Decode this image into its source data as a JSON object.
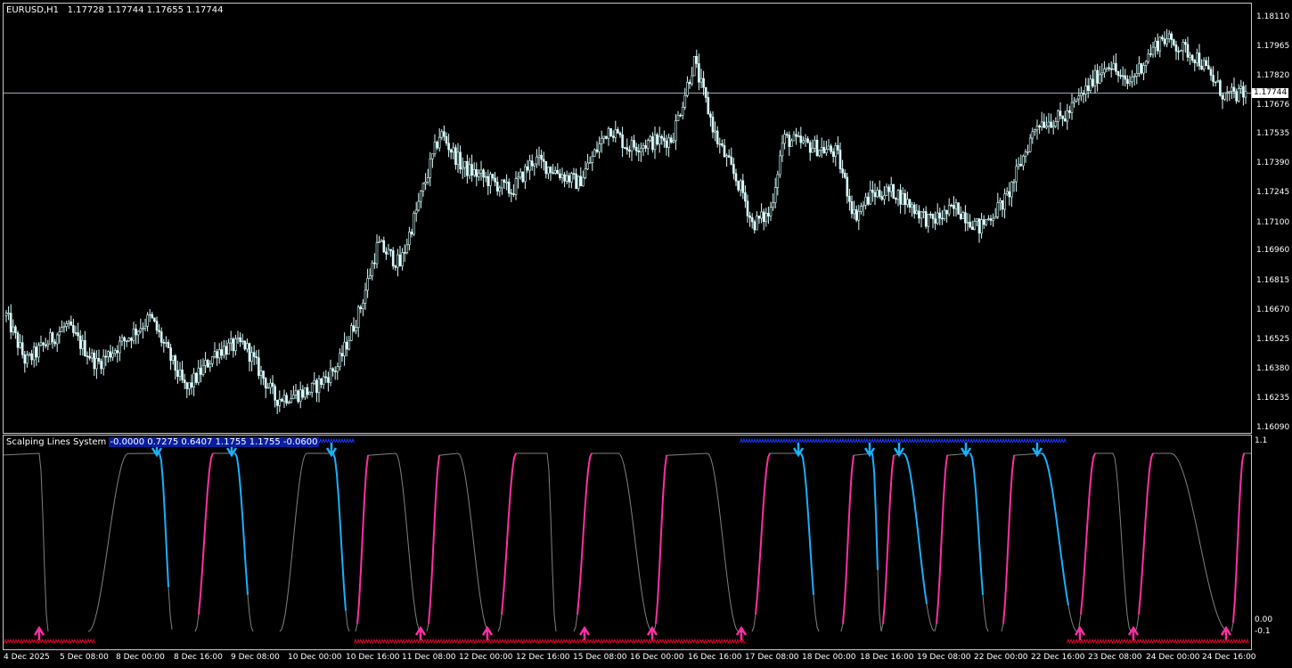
{
  "chart": {
    "symbol_label": "EURUSD,H1",
    "ohlc_label": "1.17728 1.17744 1.17655 1.17744",
    "current_price": "1.17744",
    "price_ticks": [
      "1.18110",
      "1.17965",
      "1.17820",
      "1.17676",
      "1.17535",
      "1.17390",
      "1.17245",
      "1.17100",
      "1.16960",
      "1.16815",
      "1.16670",
      "1.16525",
      "1.16380",
      "1.16235",
      "1.16090"
    ],
    "current_price_value": 1.17744
  },
  "indicator": {
    "name": "Scalping Lines System",
    "values": "-0.0000 0.7275 0.6407 1.1755 1.1755 -0.0600",
    "ticks": [
      "1.1",
      "0.00",
      "-0.1"
    ]
  },
  "time_axis": [
    "4 Dec 2025",
    "5 Dec 08:00",
    "8 Dec 00:00",
    "8 Dec 16:00",
    "9 Dec 08:00",
    "10 Dec 00:00",
    "10 Dec 16:00",
    "11 Dec 08:00",
    "12 Dec 00:00",
    "12 Dec 16:00",
    "15 Dec 08:00",
    "16 Dec 00:00",
    "16 Dec 16:00",
    "17 Dec 08:00",
    "18 Dec 00:00",
    "18 Dec 16:00",
    "19 Dec 08:00",
    "22 Dec 00:00",
    "22 Dec 16:00",
    "23 Dec 08:00",
    "24 Dec 00:00",
    "24 Dec 16:00"
  ],
  "colors": {
    "candle": "#d8fdfd",
    "pink": "#ff2fa3",
    "blue": "#1ab0ff",
    "gray": "#808080",
    "sell_marks": "#1a3cff",
    "buy_marks": "#e0002a"
  },
  "chart_data": {
    "type": "candlestick",
    "price_key_points": [
      [
        0,
        1.1668
      ],
      [
        25,
        1.1642
      ],
      [
        70,
        1.166
      ],
      [
        105,
        1.1641
      ],
      [
        165,
        1.1664
      ],
      [
        205,
        1.1628
      ],
      [
        240,
        1.1648
      ],
      [
        270,
        1.1651
      ],
      [
        305,
        1.1624
      ],
      [
        345,
        1.1628
      ],
      [
        375,
        1.164
      ],
      [
        400,
        1.1668
      ],
      [
        420,
        1.17
      ],
      [
        445,
        1.169
      ],
      [
        490,
        1.1755
      ],
      [
        515,
        1.1738
      ],
      [
        570,
        1.1726
      ],
      [
        595,
        1.1742
      ],
      [
        645,
        1.173
      ],
      [
        680,
        1.1758
      ],
      [
        700,
        1.1748
      ],
      [
        750,
        1.1752
      ],
      [
        775,
        1.179
      ],
      [
        800,
        1.1752
      ],
      [
        830,
        1.1725
      ],
      [
        840,
        1.171
      ],
      [
        860,
        1.1715
      ],
      [
        875,
        1.1752
      ],
      [
        935,
        1.1745
      ],
      [
        955,
        1.1714
      ],
      [
        975,
        1.1725
      ],
      [
        1000,
        1.1726
      ],
      [
        1040,
        1.1711
      ],
      [
        1070,
        1.1718
      ],
      [
        1095,
        1.1708
      ],
      [
        1125,
        1.1722
      ],
      [
        1160,
        1.176
      ],
      [
        1190,
        1.1762
      ],
      [
        1240,
        1.179
      ],
      [
        1260,
        1.1778
      ],
      [
        1300,
        1.1802
      ],
      [
        1340,
        1.1792
      ],
      [
        1370,
        1.1773
      ],
      [
        1395,
        1.1774
      ]
    ]
  }
}
